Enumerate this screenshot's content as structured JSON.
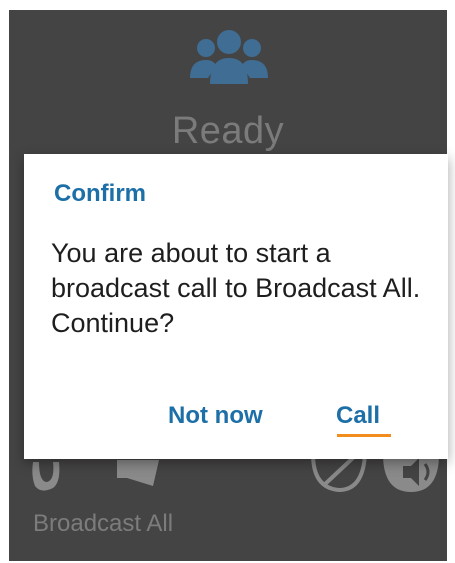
{
  "screen": {
    "status_text": "Ready",
    "footer_label": "Broadcast All",
    "icons": [
      "group-icon",
      "ptt-icon",
      "megaphone-icon",
      "phone-off-icon",
      "speaker-icon"
    ]
  },
  "dialog": {
    "title": "Confirm",
    "message": "You are about to start a broadcast call to Broadcast All. Continue?",
    "buttons": {
      "not_now": "Not now",
      "call": "Call"
    }
  },
  "colors": {
    "background": "#454444",
    "muted_text": "#7b7b7b",
    "accent": "#1d6fa8",
    "group_icon": "#3f6d93",
    "focus": "#f28c1d"
  }
}
